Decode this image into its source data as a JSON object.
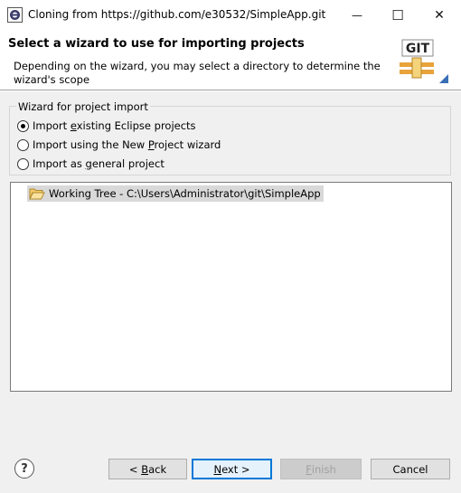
{
  "window": {
    "title": "Cloning from https://github.com/e30532/SimpleApp.git",
    "min_glyph": "—",
    "max_glyph": "☐",
    "close_glyph": "✕"
  },
  "header": {
    "title": "Select a wizard to use for importing projects",
    "description": "Depending on the wizard, you may select a directory to determine the wizard's scope",
    "git_icon": "git-icon",
    "git_label": "GIT"
  },
  "wizard_group": {
    "legend": "Wizard for project import",
    "options": [
      {
        "before": "Import ",
        "mnemonic": "e",
        "after": "xisting Eclipse projects",
        "checked": true
      },
      {
        "before": "Import using the New ",
        "mnemonic": "P",
        "after": "roject wizard",
        "checked": false
      },
      {
        "before": "Import as ",
        "mnemonic": "g",
        "after": "eneral project",
        "checked": false
      }
    ]
  },
  "tree": {
    "items": [
      {
        "label": "Working Tree - C:\\Users\\Administrator\\git\\SimpleApp",
        "icon": "folder-open-icon"
      }
    ]
  },
  "buttons": {
    "help_glyph": "?",
    "back": {
      "before": "< ",
      "mnemonic": "B",
      "after": "ack"
    },
    "next": {
      "before": "",
      "mnemonic": "N",
      "after": "ext >"
    },
    "finish": {
      "before": "",
      "mnemonic": "F",
      "after": "inish"
    },
    "cancel": "Cancel"
  }
}
